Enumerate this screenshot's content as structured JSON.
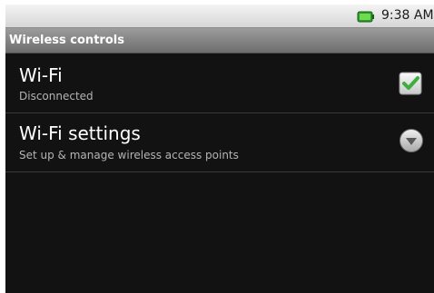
{
  "status_bar": {
    "time": "9:38 AM",
    "battery_icon": "battery-full-icon",
    "battery_color": "#2e9e2e"
  },
  "header": {
    "title": "Wireless controls"
  },
  "preferences": [
    {
      "title": "Wi-Fi",
      "summary": "Disconnected",
      "control": "checkbox",
      "checked": true,
      "icon": "checkmark-icon"
    },
    {
      "title": "Wi-Fi settings",
      "summary": "Set up & manage wireless access points",
      "control": "chevron",
      "icon": "chevron-down-icon"
    }
  ],
  "colors": {
    "background": "#121212",
    "check_green": "#3fae3f",
    "primary_text": "#ffffff",
    "secondary_text": "#b4b4b4"
  }
}
